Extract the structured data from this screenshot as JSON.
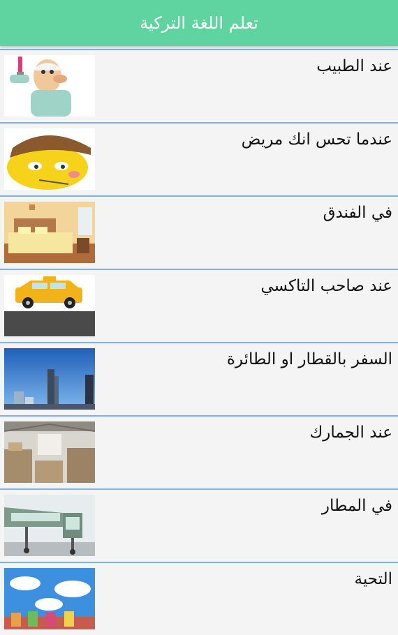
{
  "app_bar": {
    "title": "تعلم اللغة التركية"
  },
  "items": [
    {
      "label": "عند الطبيب",
      "icon": "doctor-icon"
    },
    {
      "label": "عندما تحس انك مريض",
      "icon": "sick-emoji-icon"
    },
    {
      "label": "في الفندق",
      "icon": "hotel-room-icon"
    },
    {
      "label": "عند صاحب التاكسي",
      "icon": "taxi-icon"
    },
    {
      "label": "السفر بالقطار او الطائرة",
      "icon": "city-skyline-icon"
    },
    {
      "label": "عند الجمارك",
      "icon": "warehouse-icon"
    },
    {
      "label": "في المطار",
      "icon": "airport-jetbridge-icon"
    },
    {
      "label": "التحية",
      "icon": "greeting-sky-icon"
    }
  ],
  "colors": {
    "app_bar": "#5fd3a0",
    "divider": "#7fb0e6"
  }
}
